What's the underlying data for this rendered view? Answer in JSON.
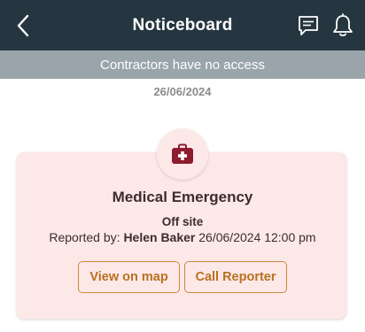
{
  "header": {
    "title": "Noticeboard",
    "back_icon": "chevron-left-icon",
    "message_icon": "message-icon",
    "bell_icon": "bell-icon"
  },
  "banner": {
    "text": "Contractors have no access"
  },
  "feed": {
    "date": "26/06/2024"
  },
  "notice": {
    "icon": "medical-kit-icon",
    "title": "Medical Emergency",
    "location": "Off site",
    "reported_by_label": "Reported by:",
    "reporter_name": "Helen Baker",
    "reported_at": "26/06/2024 12:00 pm",
    "view_map_label": "View on map",
    "call_reporter_label": "Call Reporter"
  },
  "colors": {
    "header_bg": "#263640",
    "banner_bg": "#9aa5ab",
    "card_bg": "#fde8e8",
    "accent": "#b8711f",
    "medical_icon": "#8c1c2e"
  }
}
